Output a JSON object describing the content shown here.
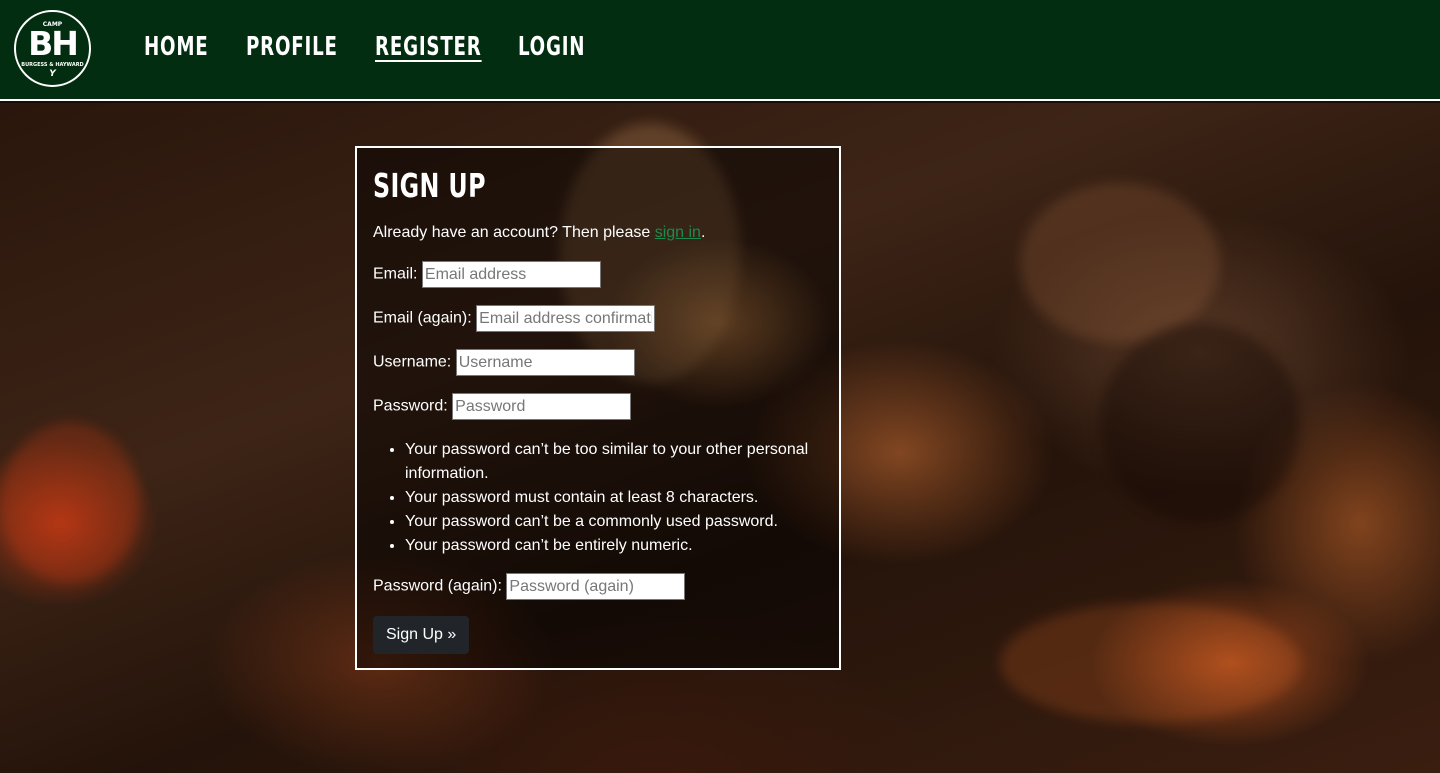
{
  "logo": {
    "camp": "CAMP",
    "letters": "BH",
    "sub": "BURGESS & HAYWARD",
    "y": "Y"
  },
  "nav": {
    "home": "HOME",
    "profile": "PROFILE",
    "register": "REGISTER",
    "login": "LOGIN"
  },
  "form": {
    "title": "SIGN UP",
    "intro_prefix": "Already have an account? Then please ",
    "intro_link": "sign in",
    "intro_suffix": ".",
    "email_label": "Email:",
    "email_placeholder": "Email address",
    "email2_label": "Email (again):",
    "email2_placeholder": "Email address confirmation",
    "username_label": "Username:",
    "username_placeholder": "Username",
    "password_label": "Password:",
    "password_placeholder": "Password",
    "password_rules": [
      "Your password can’t be too similar to your other personal information.",
      "Your password must contain at least 8 characters.",
      "Your password can’t be a commonly used password.",
      "Your password can’t be entirely numeric."
    ],
    "password2_label": "Password (again):",
    "password2_placeholder": "Password (again)",
    "submit_label": "Sign Up »"
  },
  "colors": {
    "nav_bg": "#032d10",
    "link": "#1e8a4c",
    "button": "#212529"
  }
}
